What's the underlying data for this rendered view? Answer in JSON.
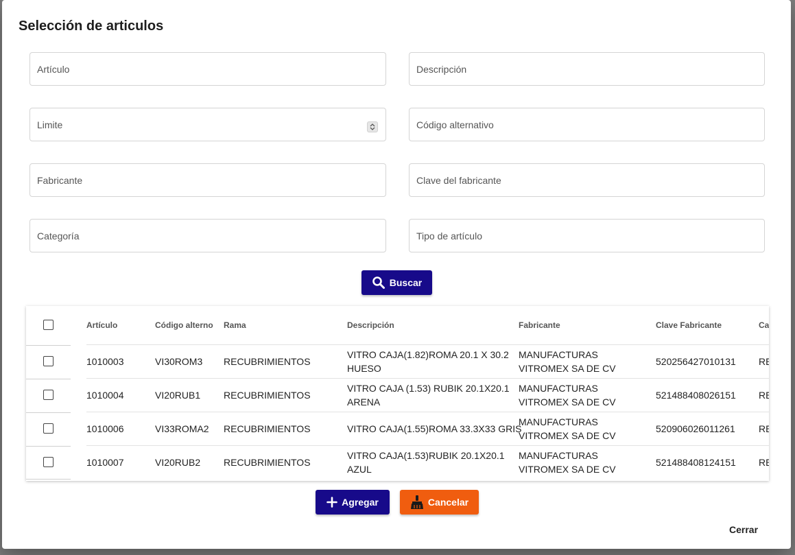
{
  "dialog": {
    "title": "Selección de articulos"
  },
  "form": {
    "articulo": "Artículo",
    "descripcion": "Descripción",
    "limite": "Limite",
    "codigo_alternativo": "Código alternativo",
    "fabricante": "Fabricante",
    "clave_fabricante": "Clave del fabricante",
    "categoria": "Categoría",
    "tipo_articulo": "Tipo de artículo"
  },
  "buttons": {
    "search": "Buscar",
    "add": "Agregar",
    "cancel": "Cancelar",
    "close": "Cerrar"
  },
  "table": {
    "headers": [
      "Artículo",
      "Código alterno",
      "Rama",
      "Descripción",
      "Fabricante",
      "Clave Fabricante",
      "Ca"
    ],
    "rows": [
      [
        "1010003",
        "VI30ROM3",
        "RECUBRIMIENTOS",
        "VITRO CAJA(1.82)ROMA 20.1 X 30.2 HUESO",
        "MANUFACTURAS VITROMEX SA DE CV",
        "520256427010131",
        "RE"
      ],
      [
        "1010004",
        "VI20RUB1",
        "RECUBRIMIENTOS",
        "VITRO CAJA (1.53) RUBIK 20.1X20.1 ARENA",
        "MANUFACTURAS VITROMEX SA DE CV",
        "521488408026151",
        "RE"
      ],
      [
        "1010006",
        "VI33ROMA2",
        "RECUBRIMIENTOS",
        "VITRO CAJA(1.55)ROMA 33.3X33 GRIS",
        "MANUFACTURAS VITROMEX SA DE CV",
        "520906026011261",
        "RE"
      ],
      [
        "1010007",
        "VI20RUB2",
        "RECUBRIMIENTOS",
        "VITRO CAJA(1.53)RUBIK 20.1X20.1 AZUL",
        "MANUFACTURAS VITROMEX SA DE CV",
        "521488408124151",
        "RE"
      ]
    ]
  },
  "colors": {
    "primary": "#170a8a",
    "accent": "#f05d0f"
  },
  "icons": {
    "search": "search-icon",
    "add": "plus-icon",
    "cancel": "broom-icon"
  }
}
